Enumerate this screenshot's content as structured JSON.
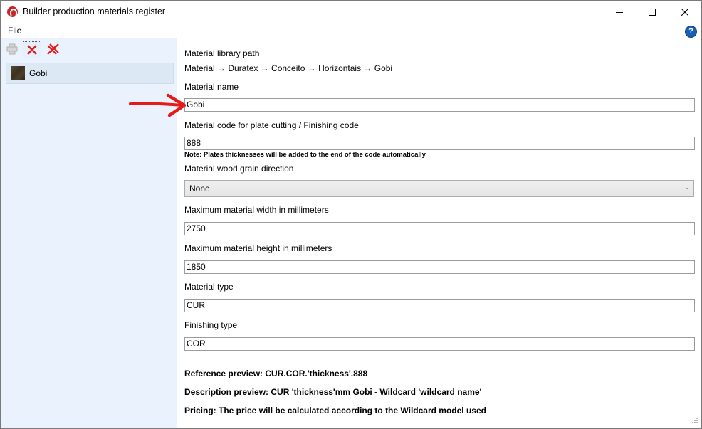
{
  "window": {
    "title": "Builder production materials register",
    "controls": {
      "minimize": "minimize-icon",
      "maximize": "maximize-icon",
      "close": "close-icon"
    }
  },
  "menu": {
    "file": "File",
    "help_icon": "help-icon"
  },
  "toolbar": {
    "add_icon": "add-material-icon",
    "delete_icon": "delete-material-icon",
    "delete_all_icon": "delete-all-materials-icon"
  },
  "materials": [
    {
      "label": "Gobi",
      "thumb": "wood-texture"
    }
  ],
  "form": {
    "library_path_label": "Material library path",
    "library_path_value": "Material → Duratex → Conceito → Horizontais → Gobi",
    "name_label": "Material name",
    "name_value": "Gobi",
    "code_label": "Material code for plate cutting / Finishing code",
    "code_value": "888",
    "code_note": "Note: Plates thicknesses will be added to the end of the code automatically",
    "grain_label": "Material wood grain direction",
    "grain_value": "None",
    "width_label": "Maximum material width in millimeters",
    "width_value": "2750",
    "height_label": "Maximum material height in millimeters",
    "height_value": "1850",
    "type_label": "Material type",
    "type_value": "CUR",
    "finishing_label": "Finishing type",
    "finishing_value": "COR"
  },
  "preview": {
    "reference": "Reference preview: CUR.COR.'thickness'.888",
    "description": "Description preview: CUR 'thickness'mm Gobi - Wildcard 'wildcard name'",
    "pricing": "Pricing: The price will be calculated according to the Wildcard model used"
  },
  "colors": {
    "accent_arrow": "#e31b1b",
    "left_panel": "#eaf3fd",
    "help": "#1a5fb4"
  }
}
